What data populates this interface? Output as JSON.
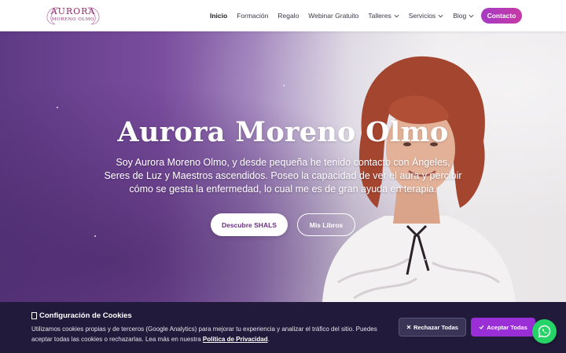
{
  "header": {
    "logo": {
      "line1": "AURORA",
      "line2": "MORENO OLMO"
    },
    "nav": [
      {
        "label": "Inicio",
        "active": true,
        "dropdown": false
      },
      {
        "label": "Formación",
        "active": false,
        "dropdown": false
      },
      {
        "label": "Regalo",
        "active": false,
        "dropdown": false
      },
      {
        "label": "Webinar Gratuito",
        "active": false,
        "dropdown": false
      },
      {
        "label": "Talleres",
        "active": false,
        "dropdown": true
      },
      {
        "label": "Servicios",
        "active": false,
        "dropdown": true
      },
      {
        "label": "Blog",
        "active": false,
        "dropdown": true
      }
    ],
    "contact_label": "Contacto"
  },
  "hero": {
    "title": "Aurora Moreno Olmo",
    "text": "Soy Aurora Moreno Olmo, y desde pequeña he tenido contacto con Ángeles, Seres de Luz y Maestros ascendidos. Poseo la capacidad de ver el aura y percibir cómo se gesta la enfermedad, lo cual me es de gran ayuda en terapia.",
    "primary_button": "Descubre SHALS",
    "secondary_button": "Mis Libros"
  },
  "cookie_banner": {
    "title": "Configuración de Cookies",
    "text_1": "Utilizamos cookies propias y de terceros (Google Analytics) para mejorar tu experiencia y analizar el tráfico del sitio. Puedes aceptar todas las cookies o rechazarlas. Lea más en nuestra ",
    "link": "Política de Privacidad",
    "text_2": ".",
    "reject_label": "Rechazar Todas",
    "accept_label": "Aceptar Todas"
  },
  "icons": {
    "chevron": "chevron-down-icon",
    "cookie_title": "cookie-icon",
    "reject": "x-icon",
    "accept": "check-icon",
    "whatsapp": "whatsapp-icon"
  },
  "colors": {
    "accent": "#9a2fd8",
    "contact_gradient_start": "#a63ac4",
    "contact_gradient_end": "#c63aa6",
    "cookie_bg": "#211a3a",
    "whatsapp": "#25d366",
    "hero_purple": "#6b3f91"
  }
}
